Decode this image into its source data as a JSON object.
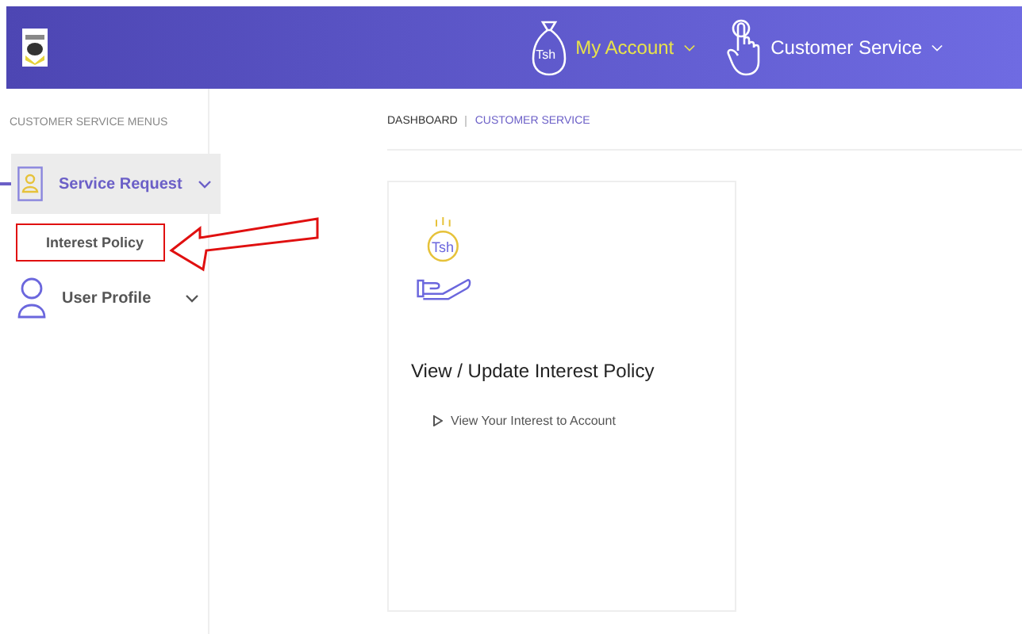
{
  "header": {
    "nav": [
      {
        "label": "My Account",
        "icon_text": "Tsh",
        "selected": true
      },
      {
        "label": "Customer Service",
        "selected": false
      }
    ]
  },
  "sidebar": {
    "title": "CUSTOMER SERVICE MENUS",
    "items": [
      {
        "label": "Service Request",
        "selected": true,
        "expanded": true,
        "children": [
          {
            "label": "Interest Policy",
            "annotated": true
          }
        ]
      },
      {
        "label": "User Profile",
        "selected": false,
        "expanded": false
      }
    ]
  },
  "breadcrumb": [
    {
      "label": "DASHBOARD",
      "current": false
    },
    {
      "label": "CUSTOMER SERVICE",
      "current": true
    }
  ],
  "card": {
    "icon_text": "Tsh",
    "title": "View / Update Interest Policy",
    "links": [
      "View Your Interest to Account"
    ]
  }
}
